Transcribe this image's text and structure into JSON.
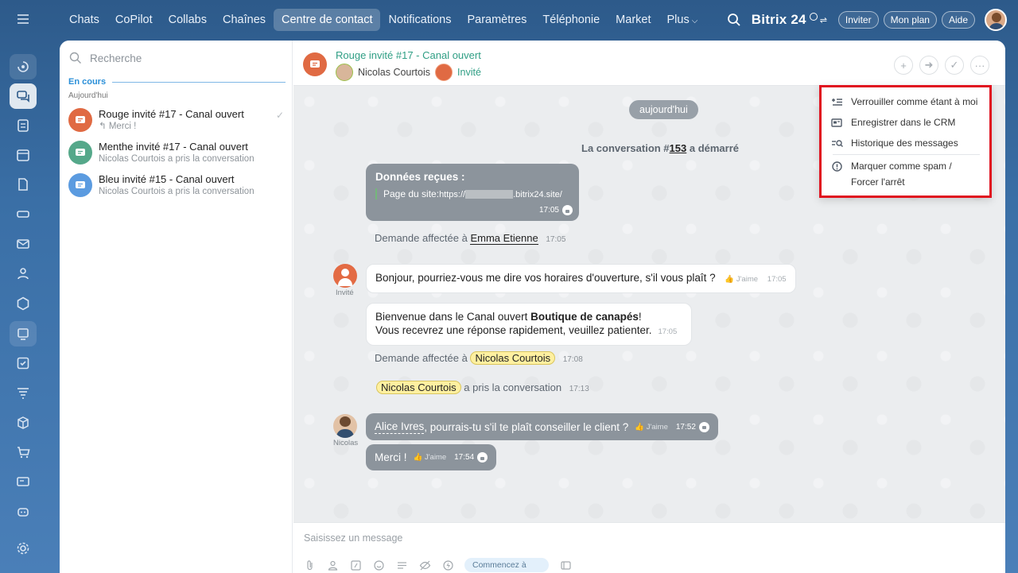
{
  "nav": {
    "items": [
      "Chats",
      "CoPilot",
      "Collabs",
      "Chaînes",
      "Centre de contact",
      "Notifications",
      "Paramètres",
      "Téléphonie",
      "Market",
      "Plus"
    ],
    "active_index": 4,
    "brand": "Bitrix 24",
    "invite": "Inviter",
    "plan": "Mon plan",
    "help": "Aide"
  },
  "list": {
    "search_placeholder": "Recherche",
    "section": "En cours",
    "day": "Aujourd'hui",
    "chats": [
      {
        "title": "Rouge invité #17 - Canal ouvert",
        "sub": "Merci !",
        "color": "#e06a43"
      },
      {
        "title": "Menthe invité #17 - Canal ouvert",
        "sub": "Nicolas Courtois a pris la conversation",
        "color": "#55a88a"
      },
      {
        "title": "Bleu invité #15 - Canal ouvert",
        "sub": "Nicolas Courtois a pris la conversation",
        "color": "#5b9be0"
      }
    ]
  },
  "header": {
    "title": "Rouge invité #17 - Canal ouvert",
    "member1": "Nicolas Courtois",
    "member2": "Invité"
  },
  "messages": {
    "date": "aujourd'hui",
    "started_prefix": "La conversation #",
    "started_num": "153",
    "started_suffix": " a démarré",
    "data_title": "Données reçues :",
    "data_label": "Page du site:",
    "data_url_prefix": "https://",
    "data_url_suffix": ".bitrix24.site/",
    "data_time": "17:05",
    "assign1_prefix": "Demande affectée à",
    "assign1_who": "Emma Etienne",
    "assign1_time": "17:05",
    "guest_label": "Invité",
    "guest_msg": "Bonjour, pourriez-vous me dire vos horaires d'ouverture, s'il vous plaît ?",
    "like": "J'aime",
    "guest_time": "17:05",
    "welcome_line1_a": "Bienvenue dans le Canal ouvert ",
    "welcome_line1_b": "Boutique de canapés",
    "welcome_line1_c": "!",
    "welcome_line2": "Vous recevrez une réponse rapidement, veuillez patienter.",
    "welcome_time": "17:05",
    "assign2_prefix": "Demande affectée à",
    "assign2_who": "Nicolas Courtois",
    "assign2_time": "17:08",
    "took_who": "Nicolas Courtois",
    "took_text": "a pris la conversation",
    "took_time": "17:13",
    "agent_label": "Nicolas",
    "agent_msg1_mention": "Alice Ivres",
    "agent_msg1_rest": ", pourrais-tu s'il te plaît conseiller le client ?",
    "agent_msg1_time": "17:52",
    "agent_msg2": "Merci !",
    "agent_msg2_time": "17:54"
  },
  "composer": {
    "placeholder": "Saisissez un message",
    "start": "Commencez à"
  },
  "menu": {
    "lock": "Verrouiller comme étant à moi",
    "crm": "Enregistrer dans le CRM",
    "history": "Historique des messages",
    "spam_line1": "Marquer comme spam /",
    "spam_line2": "Forcer l'arrêt"
  }
}
